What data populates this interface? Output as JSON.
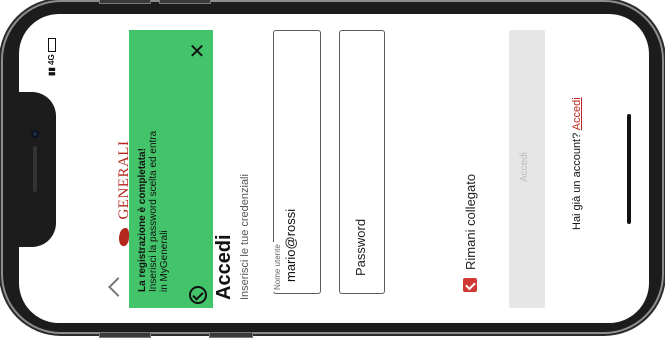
{
  "status": {
    "network": "4G"
  },
  "banner": {
    "title": "La registrazione è completata!",
    "line1": "Inserisci la password scelta ed entra",
    "line2": "in MyGenerali"
  },
  "brand": {
    "name": "GENERALI"
  },
  "login": {
    "title": "Accedi",
    "subtitle": "Inserisci le tue credenziali",
    "username_label": "Nome utente",
    "username_value": "mario@rossi",
    "password_placeholder": "Password",
    "remember_label": "Rimani collegato",
    "submit_label": "Accedi",
    "account_prompt": "Hai già un account?",
    "account_link": "Accedi"
  },
  "colors": {
    "banner": "#43c46a",
    "brand": "#b5261e",
    "checkbox": "#d13a34"
  }
}
